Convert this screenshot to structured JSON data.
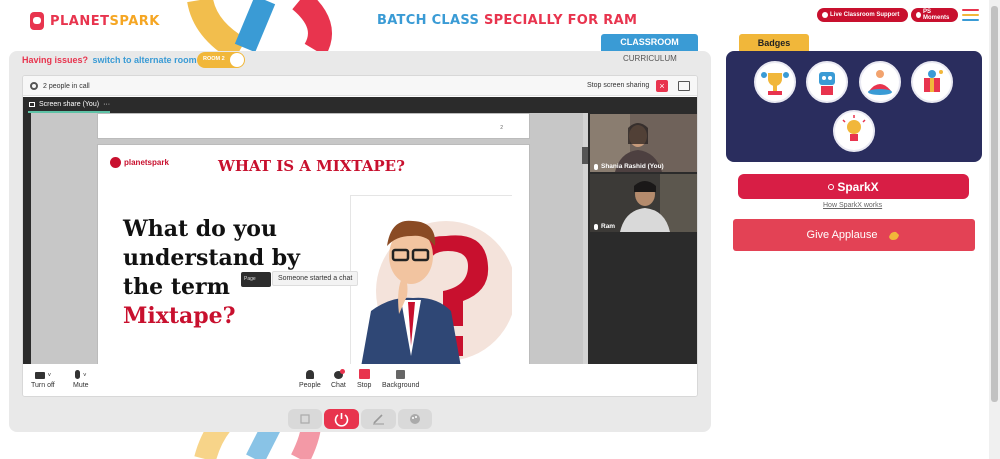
{
  "header": {
    "logo_text_1": "PLANET",
    "logo_text_2": "SPARK",
    "title_part1": "BATCH CLASS",
    "title_part2": "SPECIALLY FOR RAM",
    "live_support_label": "Live Classroom Support",
    "ps_moments_label": "PS Moments"
  },
  "tabs": {
    "classroom": "CLASSROOM",
    "curriculum": "CURRICULUM"
  },
  "room": {
    "issues_text": "Having issues?",
    "switch_text": "switch to alternate room",
    "toggle_label": "ROOM 2"
  },
  "teams": {
    "people_in_call": "2 people in call",
    "stop_sharing": "Stop screen sharing",
    "screen_share_label": "Screen share (You)",
    "more": "···",
    "participants": [
      {
        "name": "Shania Rashid (You)"
      },
      {
        "name": "Ram"
      }
    ],
    "toast_page": "Page",
    "toast_chat": "Someone started a chat",
    "controls": [
      {
        "label": "Turn off",
        "icon": "camera-icon"
      },
      {
        "label": "Mute",
        "icon": "microphone-icon"
      },
      {
        "label": "People",
        "icon": "people-icon"
      },
      {
        "label": "Chat",
        "icon": "chat-icon"
      },
      {
        "label": "Stop",
        "icon": "stop-share-icon"
      },
      {
        "label": "Background",
        "icon": "background-icon"
      }
    ]
  },
  "slide": {
    "logo": "planetspark",
    "page_mark": "2",
    "title": "WHAT IS A MIXTAPE?",
    "question_line1": "What do you",
    "question_line2": "understand by",
    "question_line3": "the term",
    "question_highlight": "Mixtape?"
  },
  "bottom_toolbar": [
    {
      "icon": "fullscreen-icon"
    },
    {
      "icon": "power-icon"
    },
    {
      "icon": "pen-icon"
    },
    {
      "icon": "palette-icon"
    }
  ],
  "right_panel": {
    "badges_title": "Badges",
    "badges": [
      {
        "icon": "trophy-badge-icon"
      },
      {
        "icon": "robot-badge-icon"
      },
      {
        "icon": "meditation-badge-icon"
      },
      {
        "icon": "gift-badge-icon"
      },
      {
        "icon": "lightbulb-badge-icon"
      }
    ],
    "sparkx_label": "SparkX",
    "how_sparkx": "How SparkX works",
    "applause_label": "Give Applause"
  },
  "colors": {
    "brand_red": "#e8344e",
    "brand_blue": "#3a9bd5",
    "brand_yellow": "#f1b73a",
    "badges_bg": "#2a2d5e",
    "sparkx_red": "#d81e45",
    "applause_red": "#e34255"
  }
}
